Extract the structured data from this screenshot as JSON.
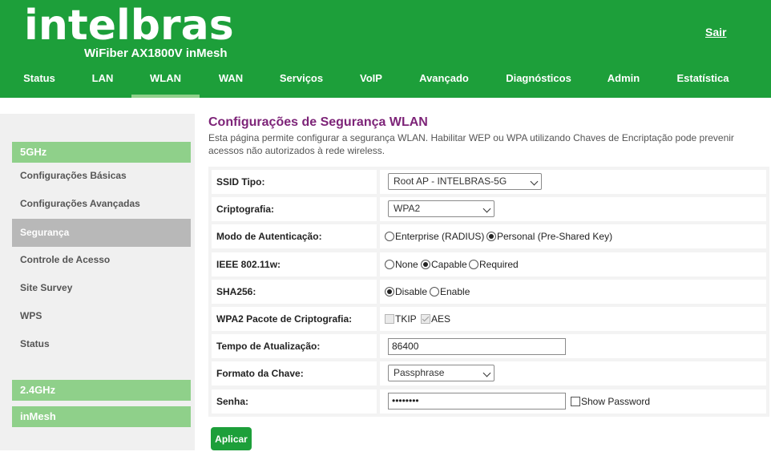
{
  "header": {
    "brand": "intelbras",
    "model": "WiFiber AX1800V inMesh",
    "logout_label": "Sair",
    "bg_color": "#1d9f3a",
    "nav": [
      {
        "label": "Status"
      },
      {
        "label": "LAN"
      },
      {
        "label": "WLAN",
        "active": true
      },
      {
        "label": "WAN"
      },
      {
        "label": "Serviços"
      },
      {
        "label": "VoIP"
      },
      {
        "label": "Avançado"
      },
      {
        "label": "Diagnósticos"
      },
      {
        "label": "Admin"
      },
      {
        "label": "Estatística"
      }
    ]
  },
  "sidebar": {
    "group_5ghz": "5GHz",
    "items": [
      {
        "label": "Configurações Básicas"
      },
      {
        "label": "Configurações Avançadas"
      },
      {
        "label": "Segurança",
        "active": true
      },
      {
        "label": "Controle de Acesso"
      },
      {
        "label": "Site Survey"
      },
      {
        "label": "WPS"
      },
      {
        "label": "Status"
      }
    ],
    "group_24ghz": "2.4GHz",
    "group_inmesh": "inMesh",
    "group_color": "#8fd08a"
  },
  "main": {
    "title": "Configurações de Segurança WLAN",
    "description": "Esta página permite configurar a segurança WLAN. Habilitar WEP ou WPA utilizando Chaves de Encriptação pode prevenir acessos não autorizados à rede wireless.",
    "title_color": "#7d2478",
    "form": {
      "ssid_type": {
        "label": "SSID Tipo:",
        "value": "Root AP - INTELBRAS-5G"
      },
      "encryption": {
        "label": "Criptografia:",
        "value": "WPA2"
      },
      "auth_mode": {
        "label": "Modo de Autenticação:",
        "options": [
          "Enterprise (RADIUS)",
          "Personal (Pre-Shared Key)"
        ],
        "selected": "Personal (Pre-Shared Key)"
      },
      "ieee80211w": {
        "label": "IEEE 802.11w:",
        "options": [
          "None",
          "Capable",
          "Required"
        ],
        "selected": "Capable"
      },
      "sha256": {
        "label": "SHA256:",
        "options": [
          "Disable",
          "Enable"
        ],
        "selected": "Disable"
      },
      "wpa2_cipher": {
        "label": "WPA2 Pacote de Criptografia:",
        "options": [
          "TKIP",
          "AES"
        ],
        "checked": [
          "AES"
        ]
      },
      "update_time": {
        "label": "Tempo de Atualização:",
        "value": "86400"
      },
      "key_format": {
        "label": "Formato da Chave:",
        "value": "Passphrase"
      },
      "password": {
        "label": "Senha:",
        "value": "••••••••",
        "show_password_label": "Show Password"
      }
    },
    "apply_label": "Aplicar"
  }
}
